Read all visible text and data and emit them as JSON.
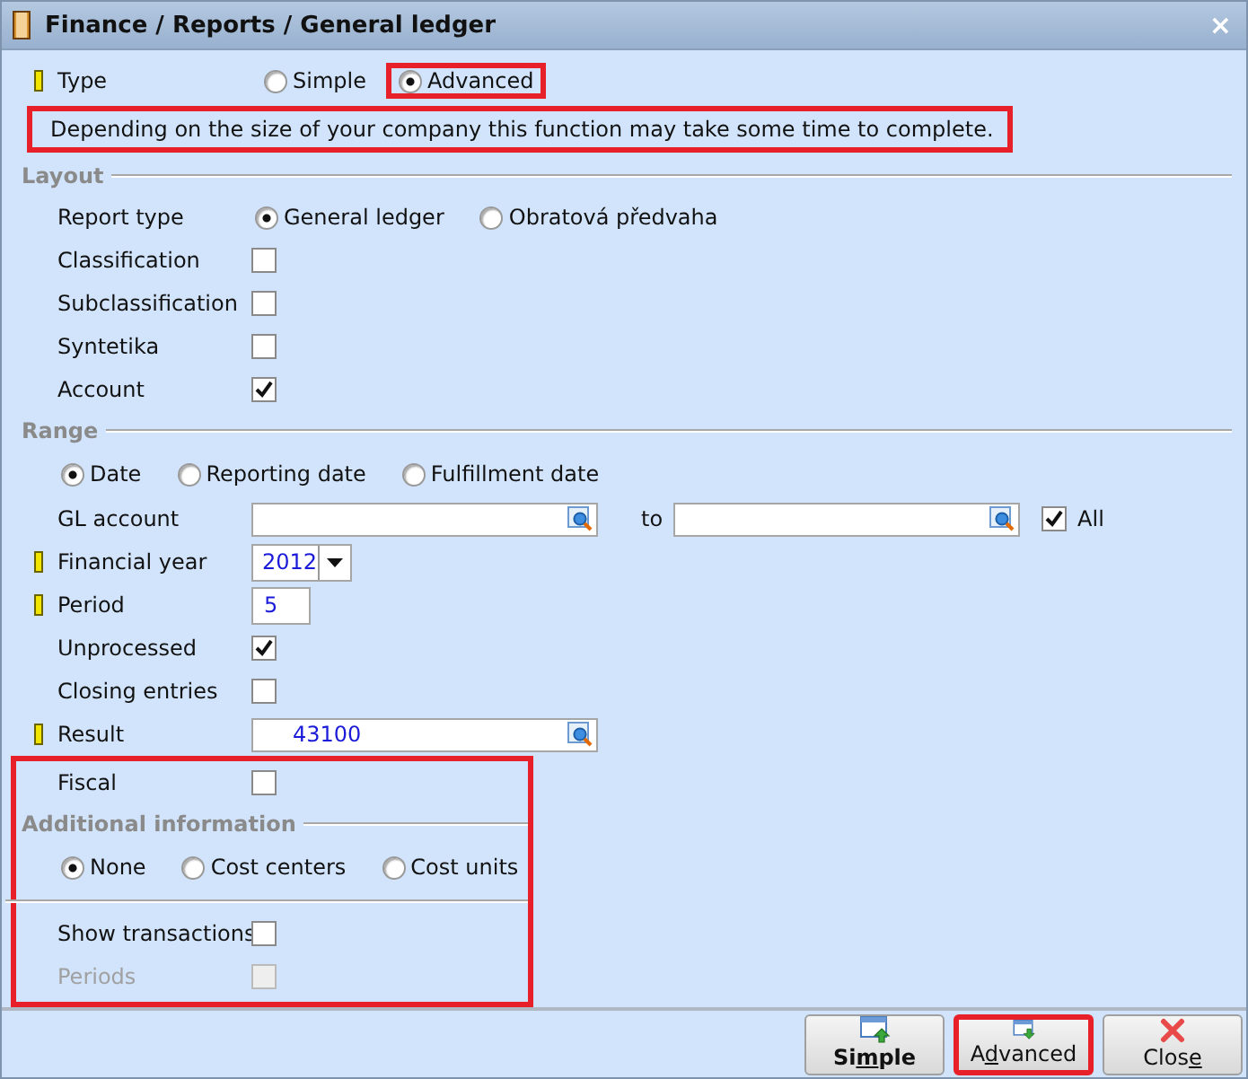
{
  "window": {
    "title": "Finance / Reports / General ledger",
    "close": "×"
  },
  "type_row": {
    "label": "Type",
    "required": true,
    "options": [
      {
        "label": "Simple",
        "selected": false,
        "highlighted": false
      },
      {
        "label": "Advanced",
        "selected": true,
        "highlighted": true
      }
    ]
  },
  "warning": {
    "text": "Depending on the size of your company this function may take some time to complete.",
    "highlighted": true
  },
  "items": [
    {
      "kind": "heading",
      "text": "Layout"
    },
    {
      "kind": "radios",
      "label": "Report type",
      "required": false,
      "options": [
        {
          "label": "General ledger",
          "selected": true
        },
        {
          "label": "Obratová předvaha",
          "selected": false
        }
      ]
    },
    {
      "kind": "checkbox",
      "label": "Classification",
      "required": false,
      "checked": false,
      "disabled": false
    },
    {
      "kind": "checkbox",
      "label": "Subclassification",
      "required": false,
      "checked": false,
      "disabled": false
    },
    {
      "kind": "checkbox",
      "label": "Syntetika",
      "required": false,
      "checked": false,
      "disabled": false
    },
    {
      "kind": "checkbox",
      "label": "Account",
      "required": false,
      "checked": true,
      "disabled": false
    },
    {
      "kind": "heading",
      "text": "Range"
    },
    {
      "kind": "radios",
      "required": false,
      "options": [
        {
          "label": "Date",
          "selected": true
        },
        {
          "label": "Reporting date",
          "selected": false
        },
        {
          "label": "Fulfillment date",
          "selected": false
        }
      ]
    },
    {
      "kind": "range",
      "label": "GL account",
      "required": false,
      "to_label": "to",
      "all": {
        "label": "All",
        "checked": true
      }
    },
    {
      "kind": "select",
      "label": "Financial year",
      "required": true,
      "value": "2012"
    },
    {
      "kind": "input",
      "label": "Period",
      "required": true,
      "value": "5"
    },
    {
      "kind": "checkbox",
      "label": "Unprocessed",
      "required": false,
      "checked": true,
      "disabled": false
    },
    {
      "kind": "checkbox",
      "label": "Closing entries",
      "required": false,
      "checked": false,
      "disabled": false
    },
    {
      "kind": "lookup",
      "label": "Result",
      "required": true,
      "value": "43100"
    },
    {
      "kind": "highlight",
      "children": [
        {
          "kind": "checkbox",
          "label": "Fiscal",
          "required": false,
          "checked": false,
          "disabled": false
        },
        {
          "kind": "heading",
          "text": "Additional information"
        },
        {
          "kind": "radios",
          "required": false,
          "options": [
            {
              "label": "None",
              "selected": true
            },
            {
              "label": "Cost centers",
              "selected": false
            },
            {
              "label": "Cost units",
              "selected": false
            }
          ]
        },
        {
          "kind": "divider"
        },
        {
          "kind": "checkbox",
          "label": "Show transactions",
          "required": false,
          "checked": false,
          "disabled": false
        },
        {
          "kind": "checkbox",
          "label": "Periods",
          "required": false,
          "checked": false,
          "disabled": true
        }
      ]
    }
  ],
  "buttons": [
    {
      "kind": "simple",
      "before": "Si",
      "key": "m",
      "after": "ple",
      "default": true,
      "highlighted": false
    },
    {
      "kind": "advanced",
      "before": "A",
      "key": "d",
      "after": "vanced",
      "default": false,
      "highlighted": true
    },
    {
      "kind": "close",
      "before": "Clos",
      "key": "e",
      "default": false,
      "highlighted": false
    }
  ]
}
